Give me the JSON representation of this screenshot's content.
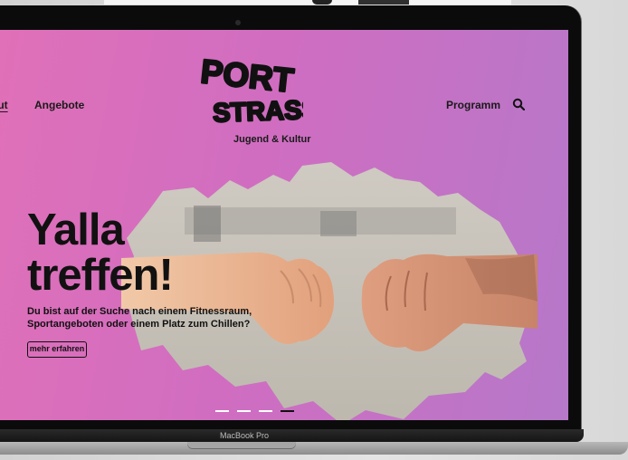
{
  "nav": {
    "about_label": "out",
    "angebote_label": "Angebote",
    "programm_label": "Programm",
    "search_icon": "search-icon"
  },
  "logo": {
    "line1": "PORT",
    "line2": "STRASSE"
  },
  "tagline": "Jugend & Kultur",
  "hero": {
    "headline_line1": "Yalla",
    "headline_line2": "treffen!",
    "subtext": "Du bist auf der Suche nach einem Fitnessraum, Sportangeboten oder einem Platz zum Chillen?",
    "cta_label": "mehr erfahren"
  },
  "carousel": {
    "slide_count": 4,
    "active_index": 3
  },
  "device": {
    "model_label": "MacBook Pro"
  },
  "colors": {
    "accent_pink": "#e070b8",
    "accent_purple": "#b678c9",
    "text": "#111111"
  }
}
